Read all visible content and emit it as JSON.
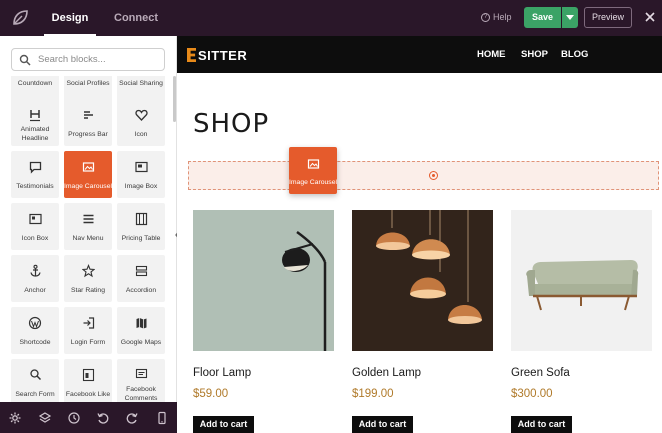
{
  "topbar": {
    "tabs": [
      {
        "label": "Design",
        "active": true
      },
      {
        "label": "Connect",
        "active": false
      }
    ],
    "help_label": "Help",
    "help_glyph": "?",
    "save_label": "Save",
    "preview_label": "Preview"
  },
  "sidebar": {
    "search_placeholder": "Search blocks...",
    "blocks": [
      {
        "label": "Countdown",
        "icon": "countdown-icon"
      },
      {
        "label": "Social Profiles",
        "icon": "social-profiles-icon"
      },
      {
        "label": "Social Sharing",
        "icon": "social-sharing-icon"
      },
      {
        "label": "Animated Headline",
        "icon": "heading-icon"
      },
      {
        "label": "Progress Bar",
        "icon": "progress-bar-icon"
      },
      {
        "label": "Icon",
        "icon": "heart-icon"
      },
      {
        "label": "Testimonials",
        "icon": "chat-bubble-icon"
      },
      {
        "label": "Image Carousel",
        "icon": "image-carousel-icon",
        "active": true
      },
      {
        "label": "Image Box",
        "icon": "image-box-icon"
      },
      {
        "label": "Icon Box",
        "icon": "icon-box-icon"
      },
      {
        "label": "Nav Menu",
        "icon": "menu-icon"
      },
      {
        "label": "Pricing Table",
        "icon": "pricing-table-icon"
      },
      {
        "label": "Anchor",
        "icon": "anchor-icon"
      },
      {
        "label": "Star Rating",
        "icon": "star-icon"
      },
      {
        "label": "Accordion",
        "icon": "accordion-icon"
      },
      {
        "label": "Shortcode",
        "icon": "wordpress-icon"
      },
      {
        "label": "Login Form",
        "icon": "login-icon"
      },
      {
        "label": "Google Maps",
        "icon": "map-icon"
      },
      {
        "label": "Search Form",
        "icon": "search-icon"
      },
      {
        "label": "Facebook Like",
        "icon": "facebook-like-icon"
      },
      {
        "label": "Facebook Comments",
        "icon": "facebook-comments-icon"
      }
    ]
  },
  "bottombar": {
    "icons": [
      "gear-icon",
      "layers-icon",
      "history-icon",
      "undo-icon",
      "redo-icon",
      "mobile-preview-icon"
    ]
  },
  "site": {
    "brand": "SITTER",
    "nav": [
      "HOME",
      "SHOP",
      "BLOG"
    ],
    "heading": "SHOP",
    "drag_label": "Image Carousel",
    "products": [
      {
        "name": "Floor Lamp",
        "price": "$59.00",
        "button": "Add to cart"
      },
      {
        "name": "Golden Lamp",
        "price": "$199.00",
        "button": "Add to cart"
      },
      {
        "name": "Green Sofa",
        "price": "$300.00",
        "button": "Add to cart"
      }
    ]
  },
  "colors": {
    "topbar_bg": "#2a1729",
    "accent_orange": "#e55b2c",
    "save_green": "#3ba366",
    "price_gold": "#b07a2a",
    "brand_orange": "#e88a1a"
  }
}
